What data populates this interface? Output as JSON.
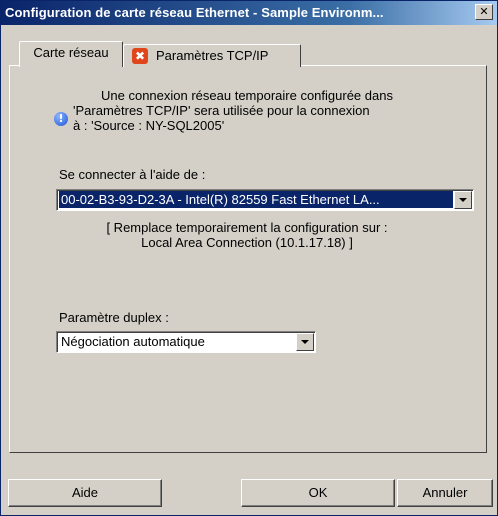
{
  "window": {
    "title": "Configuration de carte réseau Ethernet - Sample Environm...",
    "close_glyph": "✕"
  },
  "tabs": [
    {
      "label": "Carte réseau",
      "active": true
    },
    {
      "label": "Paramètres TCP/IP",
      "active": false,
      "icon": "error-x-icon",
      "icon_glyph": "✖"
    }
  ],
  "info": {
    "icon": "info-icon",
    "icon_glyph": "!",
    "line1": "Une connexion réseau temporaire configurée dans",
    "line2": "'Paramètres TCP/IP' sera utilisée pour la connexion",
    "line3": "à : 'Source : NY-SQL2005'"
  },
  "connect": {
    "label": "Se connecter à l'aide de :",
    "selected": "00-02-B3-93-D2-3A  -  Intel(R)  82559  Fast  Ethernet  LA..."
  },
  "replace": {
    "line1": "[ Remplace temporairement la configuration sur :",
    "line2": "Local Area Connection (10.1.17.18) ]"
  },
  "duplex": {
    "label": "Paramètre duplex :",
    "selected": "Négociation automatique"
  },
  "buttons": {
    "help": "Aide",
    "ok": "OK",
    "cancel": "Annuler"
  },
  "colors": {
    "title_gradient_start": "#0a246a",
    "selection": "#0a246a",
    "face": "#d4d0c8"
  }
}
